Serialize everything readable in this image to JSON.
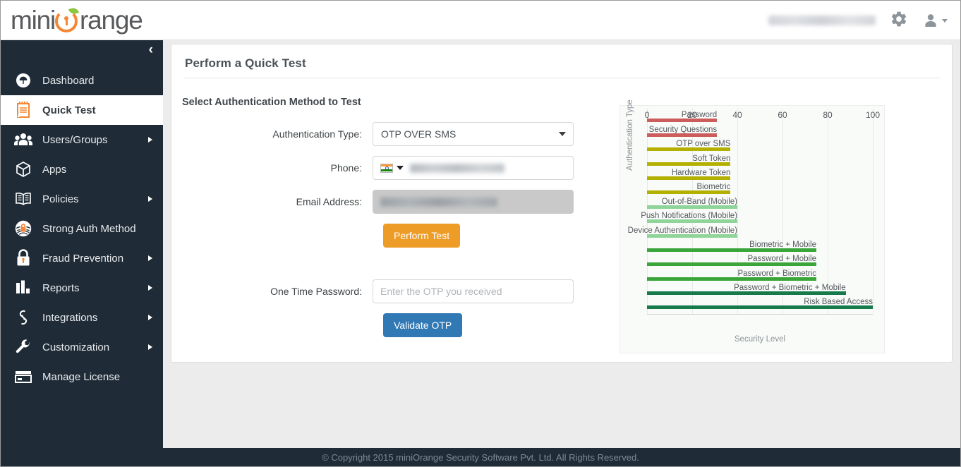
{
  "header": {
    "logo_text_1": "mini",
    "logo_text_2": "range",
    "logo_o_icon": "orange-keyhole-icon",
    "user_email": "",
    "gear_icon": "gear-icon",
    "user_icon": "user-avatar-icon"
  },
  "sidebar": {
    "collapse_label": "‹",
    "items": [
      {
        "label": "Dashboard",
        "icon": "dashboard-gauge-icon",
        "active": false,
        "has_arrow": false
      },
      {
        "label": "Quick Test",
        "icon": "notepad-icon",
        "active": true,
        "has_arrow": false
      },
      {
        "label": "Users/Groups",
        "icon": "users-group-icon",
        "active": false,
        "has_arrow": true
      },
      {
        "label": "Apps",
        "icon": "cube-box-icon",
        "active": false,
        "has_arrow": false
      },
      {
        "label": "Policies",
        "icon": "open-book-icon",
        "active": false,
        "has_arrow": true
      },
      {
        "label": "Strong Auth Method",
        "icon": "fingerprint-lock-icon",
        "active": false,
        "has_arrow": false
      },
      {
        "label": "Fraud Prevention",
        "icon": "padlock-icon",
        "active": false,
        "has_arrow": true
      },
      {
        "label": "Reports",
        "icon": "bar-chart-icon",
        "active": false,
        "has_arrow": true
      },
      {
        "label": "Integrations",
        "icon": "chain-link-icon",
        "active": false,
        "has_arrow": true
      },
      {
        "label": "Customization",
        "icon": "wrench-icon",
        "active": false,
        "has_arrow": true
      },
      {
        "label": "Manage License",
        "icon": "credit-card-icon",
        "active": false,
        "has_arrow": false
      }
    ]
  },
  "panel": {
    "title": "Perform a Quick Test",
    "section_title": "Select Authentication Method to Test",
    "fields": {
      "auth_type_label": "Authentication Type:",
      "auth_type_value": "OTP OVER SMS",
      "phone_label": "Phone:",
      "phone_value": "",
      "phone_country_flag": "india-flag-icon",
      "email_label": "Email Address:",
      "email_value": "",
      "otp_label": "One Time Password:",
      "otp_value": "",
      "otp_placeholder": "Enter the OTP you received"
    },
    "buttons": {
      "perform_test": "Perform Test",
      "validate_otp": "Validate OTP"
    }
  },
  "chart_data": {
    "type": "bar",
    "orientation": "horizontal",
    "title": "",
    "xlabel": "Security Level",
    "ylabel": "Authentication Type",
    "xlim": [
      0,
      100
    ],
    "xticks": [
      0,
      20,
      40,
      60,
      80,
      100
    ],
    "grid": true,
    "legend": "none",
    "categories": [
      "Password",
      "Security Questions",
      "OTP over SMS",
      "Soft Token",
      "Hardware Token",
      "Biometric",
      "Out-of-Band (Mobile)",
      "Push Notifications (Mobile)",
      "Device Authentication (Mobile)",
      "Biometric + Mobile",
      "Password + Mobile",
      "Password + Biometric",
      "Password + Biometric + Mobile",
      "Risk Based Access"
    ],
    "values": [
      31,
      31,
      37,
      37,
      37,
      37,
      40,
      40,
      40,
      75,
      75,
      75,
      88,
      100
    ],
    "colors": [
      "#cd5c5c",
      "#cd5c5c",
      "#b3b000",
      "#b3b000",
      "#b3b000",
      "#b3b000",
      "#90d49a",
      "#90d49a",
      "#90d49a",
      "#3aa63a",
      "#3aa63a",
      "#3aa63a",
      "#177a4a",
      "#177a4a"
    ]
  },
  "footer": {
    "copyright": "© Copyright 2015 miniOrange Security Software Pvt. Ltd. All Rights Reserved."
  },
  "theme": {
    "sidebar_bg": "#1f2c38",
    "accent_orange": "#f58634",
    "button_orange": "#ee9c28",
    "button_blue": "#3079b5"
  }
}
